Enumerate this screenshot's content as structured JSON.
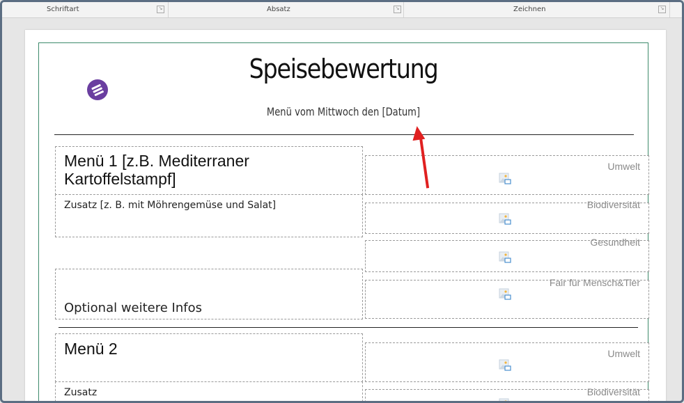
{
  "ribbon": {
    "groups": [
      {
        "label": "Schriftart"
      },
      {
        "label": "Absatz"
      },
      {
        "label": "Zeichnen"
      }
    ]
  },
  "document": {
    "title": "Speisebewertung",
    "subtitle": "Menü vom Mittwoch den [Datum]",
    "menu1": {
      "title": "Menü 1 [z.B. Mediterraner Kartoffelstampf]",
      "addon": "Zusatz [z. B. mit Möhrengemüse und Salat]",
      "optional": "Optional weitere Infos",
      "criteria": [
        "Umwelt",
        "Biodiversität",
        "Gesundheit",
        "Fair für Mensch&Tier"
      ]
    },
    "menu2": {
      "title": "Menü 2",
      "addon": "Zusatz",
      "criteria": [
        "Umwelt",
        "Biodiversität"
      ]
    }
  },
  "colors": {
    "frame_border": "#3d8a6b",
    "logo": "#6a3ea0",
    "arrow": "#e02020",
    "criteria_text": "#8a8a8a"
  },
  "icons": [
    "logo-icon",
    "picture-placeholder-icon",
    "dialog-launcher-icon"
  ]
}
